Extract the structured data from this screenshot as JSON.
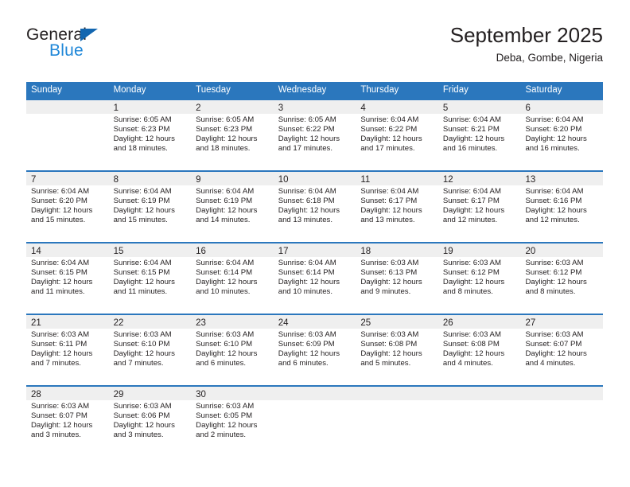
{
  "logo": {
    "text_top": "General",
    "text_bottom": "Blue",
    "triangle_color": "#1266b0",
    "blue_color": "#1f87d8"
  },
  "header": {
    "title": "September 2025",
    "subtitle": "Deba, Gombe, Nigeria"
  },
  "theme": {
    "header_blue": "#2b77bd",
    "day_band_gray": "#efefef",
    "text_color": "#231f20"
  },
  "weekdays": [
    "Sunday",
    "Monday",
    "Tuesday",
    "Wednesday",
    "Thursday",
    "Friday",
    "Saturday"
  ],
  "weeks": [
    [
      {
        "day": "",
        "sunrise": "",
        "sunset": "",
        "daylight_line1": "",
        "daylight_line2": ""
      },
      {
        "day": "1",
        "sunrise": "Sunrise: 6:05 AM",
        "sunset": "Sunset: 6:23 PM",
        "daylight_line1": "Daylight: 12 hours",
        "daylight_line2": "and 18 minutes."
      },
      {
        "day": "2",
        "sunrise": "Sunrise: 6:05 AM",
        "sunset": "Sunset: 6:23 PM",
        "daylight_line1": "Daylight: 12 hours",
        "daylight_line2": "and 18 minutes."
      },
      {
        "day": "3",
        "sunrise": "Sunrise: 6:05 AM",
        "sunset": "Sunset: 6:22 PM",
        "daylight_line1": "Daylight: 12 hours",
        "daylight_line2": "and 17 minutes."
      },
      {
        "day": "4",
        "sunrise": "Sunrise: 6:04 AM",
        "sunset": "Sunset: 6:22 PM",
        "daylight_line1": "Daylight: 12 hours",
        "daylight_line2": "and 17 minutes."
      },
      {
        "day": "5",
        "sunrise": "Sunrise: 6:04 AM",
        "sunset": "Sunset: 6:21 PM",
        "daylight_line1": "Daylight: 12 hours",
        "daylight_line2": "and 16 minutes."
      },
      {
        "day": "6",
        "sunrise": "Sunrise: 6:04 AM",
        "sunset": "Sunset: 6:20 PM",
        "daylight_line1": "Daylight: 12 hours",
        "daylight_line2": "and 16 minutes."
      }
    ],
    [
      {
        "day": "7",
        "sunrise": "Sunrise: 6:04 AM",
        "sunset": "Sunset: 6:20 PM",
        "daylight_line1": "Daylight: 12 hours",
        "daylight_line2": "and 15 minutes."
      },
      {
        "day": "8",
        "sunrise": "Sunrise: 6:04 AM",
        "sunset": "Sunset: 6:19 PM",
        "daylight_line1": "Daylight: 12 hours",
        "daylight_line2": "and 15 minutes."
      },
      {
        "day": "9",
        "sunrise": "Sunrise: 6:04 AM",
        "sunset": "Sunset: 6:19 PM",
        "daylight_line1": "Daylight: 12 hours",
        "daylight_line2": "and 14 minutes."
      },
      {
        "day": "10",
        "sunrise": "Sunrise: 6:04 AM",
        "sunset": "Sunset: 6:18 PM",
        "daylight_line1": "Daylight: 12 hours",
        "daylight_line2": "and 13 minutes."
      },
      {
        "day": "11",
        "sunrise": "Sunrise: 6:04 AM",
        "sunset": "Sunset: 6:17 PM",
        "daylight_line1": "Daylight: 12 hours",
        "daylight_line2": "and 13 minutes."
      },
      {
        "day": "12",
        "sunrise": "Sunrise: 6:04 AM",
        "sunset": "Sunset: 6:17 PM",
        "daylight_line1": "Daylight: 12 hours",
        "daylight_line2": "and 12 minutes."
      },
      {
        "day": "13",
        "sunrise": "Sunrise: 6:04 AM",
        "sunset": "Sunset: 6:16 PM",
        "daylight_line1": "Daylight: 12 hours",
        "daylight_line2": "and 12 minutes."
      }
    ],
    [
      {
        "day": "14",
        "sunrise": "Sunrise: 6:04 AM",
        "sunset": "Sunset: 6:15 PM",
        "daylight_line1": "Daylight: 12 hours",
        "daylight_line2": "and 11 minutes."
      },
      {
        "day": "15",
        "sunrise": "Sunrise: 6:04 AM",
        "sunset": "Sunset: 6:15 PM",
        "daylight_line1": "Daylight: 12 hours",
        "daylight_line2": "and 11 minutes."
      },
      {
        "day": "16",
        "sunrise": "Sunrise: 6:04 AM",
        "sunset": "Sunset: 6:14 PM",
        "daylight_line1": "Daylight: 12 hours",
        "daylight_line2": "and 10 minutes."
      },
      {
        "day": "17",
        "sunrise": "Sunrise: 6:04 AM",
        "sunset": "Sunset: 6:14 PM",
        "daylight_line1": "Daylight: 12 hours",
        "daylight_line2": "and 10 minutes."
      },
      {
        "day": "18",
        "sunrise": "Sunrise: 6:03 AM",
        "sunset": "Sunset: 6:13 PM",
        "daylight_line1": "Daylight: 12 hours",
        "daylight_line2": "and 9 minutes."
      },
      {
        "day": "19",
        "sunrise": "Sunrise: 6:03 AM",
        "sunset": "Sunset: 6:12 PM",
        "daylight_line1": "Daylight: 12 hours",
        "daylight_line2": "and 8 minutes."
      },
      {
        "day": "20",
        "sunrise": "Sunrise: 6:03 AM",
        "sunset": "Sunset: 6:12 PM",
        "daylight_line1": "Daylight: 12 hours",
        "daylight_line2": "and 8 minutes."
      }
    ],
    [
      {
        "day": "21",
        "sunrise": "Sunrise: 6:03 AM",
        "sunset": "Sunset: 6:11 PM",
        "daylight_line1": "Daylight: 12 hours",
        "daylight_line2": "and 7 minutes."
      },
      {
        "day": "22",
        "sunrise": "Sunrise: 6:03 AM",
        "sunset": "Sunset: 6:10 PM",
        "daylight_line1": "Daylight: 12 hours",
        "daylight_line2": "and 7 minutes."
      },
      {
        "day": "23",
        "sunrise": "Sunrise: 6:03 AM",
        "sunset": "Sunset: 6:10 PM",
        "daylight_line1": "Daylight: 12 hours",
        "daylight_line2": "and 6 minutes."
      },
      {
        "day": "24",
        "sunrise": "Sunrise: 6:03 AM",
        "sunset": "Sunset: 6:09 PM",
        "daylight_line1": "Daylight: 12 hours",
        "daylight_line2": "and 6 minutes."
      },
      {
        "day": "25",
        "sunrise": "Sunrise: 6:03 AM",
        "sunset": "Sunset: 6:08 PM",
        "daylight_line1": "Daylight: 12 hours",
        "daylight_line2": "and 5 minutes."
      },
      {
        "day": "26",
        "sunrise": "Sunrise: 6:03 AM",
        "sunset": "Sunset: 6:08 PM",
        "daylight_line1": "Daylight: 12 hours",
        "daylight_line2": "and 4 minutes."
      },
      {
        "day": "27",
        "sunrise": "Sunrise: 6:03 AM",
        "sunset": "Sunset: 6:07 PM",
        "daylight_line1": "Daylight: 12 hours",
        "daylight_line2": "and 4 minutes."
      }
    ],
    [
      {
        "day": "28",
        "sunrise": "Sunrise: 6:03 AM",
        "sunset": "Sunset: 6:07 PM",
        "daylight_line1": "Daylight: 12 hours",
        "daylight_line2": "and 3 minutes."
      },
      {
        "day": "29",
        "sunrise": "Sunrise: 6:03 AM",
        "sunset": "Sunset: 6:06 PM",
        "daylight_line1": "Daylight: 12 hours",
        "daylight_line2": "and 3 minutes."
      },
      {
        "day": "30",
        "sunrise": "Sunrise: 6:03 AM",
        "sunset": "Sunset: 6:05 PM",
        "daylight_line1": "Daylight: 12 hours",
        "daylight_line2": "and 2 minutes."
      },
      {
        "day": "",
        "sunrise": "",
        "sunset": "",
        "daylight_line1": "",
        "daylight_line2": ""
      },
      {
        "day": "",
        "sunrise": "",
        "sunset": "",
        "daylight_line1": "",
        "daylight_line2": ""
      },
      {
        "day": "",
        "sunrise": "",
        "sunset": "",
        "daylight_line1": "",
        "daylight_line2": ""
      },
      {
        "day": "",
        "sunrise": "",
        "sunset": "",
        "daylight_line1": "",
        "daylight_line2": ""
      }
    ]
  ]
}
